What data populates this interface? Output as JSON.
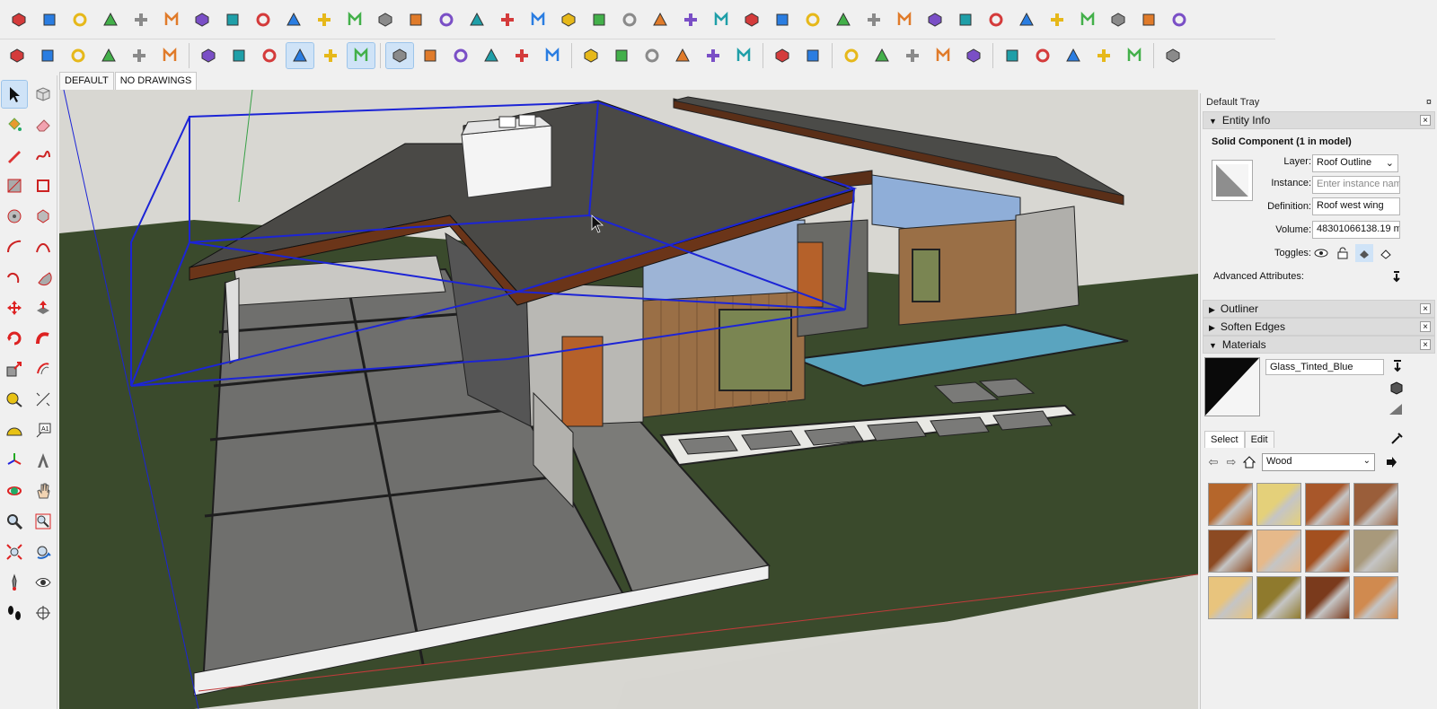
{
  "app": {
    "toolbar_top_icons": [
      "orient-faces-icon",
      "extrude-icon",
      "offset-icon",
      "move-icon",
      "flip-icon",
      "unglue-icon",
      "rotate-icon",
      "section-icon",
      "list-icon",
      "flag-icon",
      "layers-icon",
      "link-icon",
      "arc-icon",
      "polyline-icon",
      "curve-icon",
      "cross-icon",
      "plus-icon",
      "axes-icon",
      "cone-icon",
      "material-icon",
      "warning-icon",
      "spin-icon",
      "spin-alt-icon",
      "spin-3-icon",
      "sparkle-icon",
      "box-icon",
      "magnet-icon",
      "puzzle-icon",
      "paint-bucket-icon",
      "cut-icon",
      "fill-icon",
      "layers-3-icon",
      "grid-blue-icon",
      "grid-orange-icon",
      "grid-orange-2-icon",
      "grid-orange-3-icon",
      "scatter-icon",
      "path-icon",
      "matrix-icon"
    ],
    "toolbar_second_icons": [
      "warehouse-icon",
      "doors-icon",
      "home-icon",
      "printer-home-icon",
      "outline-home-icon",
      "garage-icon",
      "xray-box-icon",
      "wireframe-icon",
      "hidden-line-icon",
      "shaded-icon",
      "shaded-texture-icon",
      "monochrome-icon",
      "iso-view-icon",
      "top-view-icon",
      "front-view-icon",
      "right-view-icon",
      "back-view-icon",
      "left-view-icon",
      "union-icon",
      "intersect-icon",
      "subtract-icon",
      "trim-icon",
      "split-icon",
      "shell-icon",
      "arrow-up-icon",
      "arrow-double-icon",
      "fog-icon",
      "shadow-icon",
      "sandbox-icon",
      "terrain-icon",
      "binoculars-icon",
      "warehouse-yellow-icon",
      "tree-green-icon",
      "cube-blue-icon",
      "cube-purple-icon",
      "recycle-icon",
      "compass-icon"
    ]
  },
  "scene_tabs": [
    {
      "label": "DEFAULT"
    },
    {
      "label": "NO DRAWINGS"
    }
  ],
  "tray": {
    "title": "Default Tray",
    "pin_glyph": "¤",
    "entity_info": {
      "header": "Entity Info",
      "title": "Solid Component (1 in model)",
      "layer_label": "Layer:",
      "layer_value": "Roof Outline",
      "instance_label": "Instance:",
      "instance_placeholder": "Enter instance nam",
      "definition_label": "Definition:",
      "definition_value": "Roof west wing",
      "volume_label": "Volume:",
      "volume_value": "48301066138.19 m",
      "toggles_label": "Toggles:",
      "advanced_label": "Advanced Attributes:"
    },
    "outliner": {
      "header": "Outliner"
    },
    "soften_edges": {
      "header": "Soften Edges"
    },
    "materials": {
      "header": "Materials",
      "current_name": "Glass_Tinted_Blue",
      "tab_select": "Select",
      "tab_edit": "Edit",
      "library": "Wood",
      "swatch_colors": [
        "#b5662b",
        "#e4d07a",
        "#a8572a",
        "#9a5e3a",
        "#8c4a22",
        "#e6b98a",
        "#a3501f",
        "#a8997b",
        "#e8c47d",
        "#8f7a2d",
        "#7a3a1c",
        "#d08a4f"
      ]
    }
  },
  "viewport": {
    "sky_color": "#d8d7d2",
    "ground_color": "#3a4a2c",
    "selection_color": "#1c24d6"
  }
}
